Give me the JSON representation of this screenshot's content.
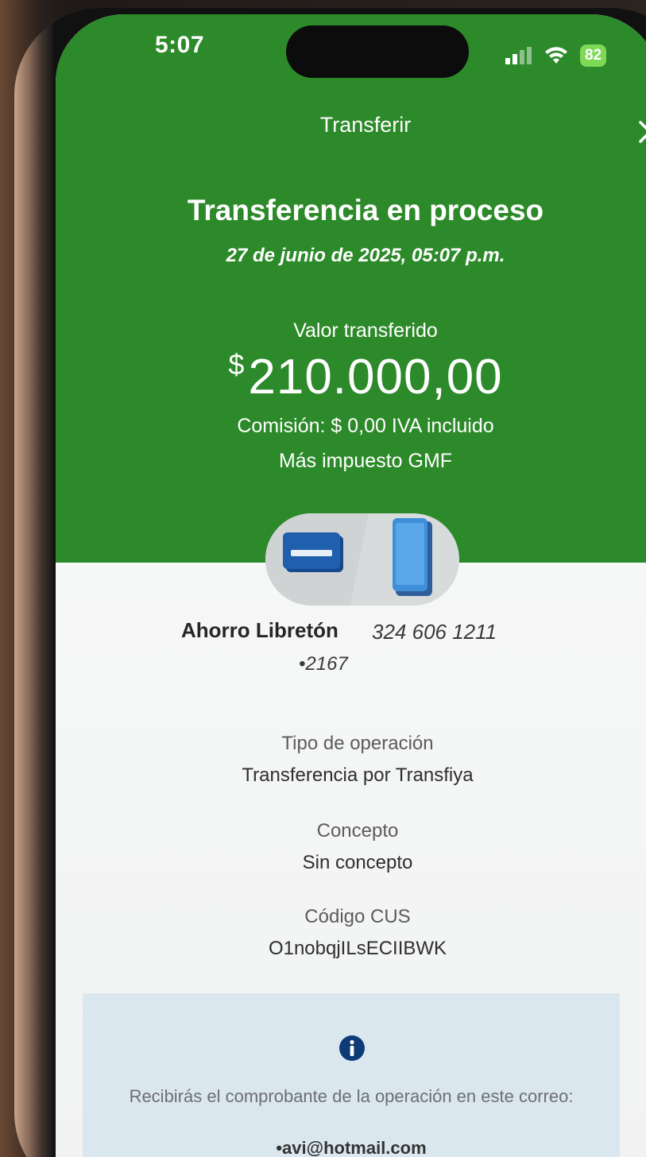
{
  "status_bar": {
    "time": "5:07",
    "battery": "82"
  },
  "header": {
    "title": "Transferir"
  },
  "result": {
    "headline": "Transferencia en proceso",
    "date": "27 de junio de 2025, 05:07 p.m.",
    "value_label": "Valor transferido",
    "currency_symbol": "$",
    "amount": "210.000,00",
    "commission": "Comisión: $ 0,00 IVA incluido",
    "tax_note": "Más impuesto GMF"
  },
  "account": {
    "name": "Ahorro Libretón",
    "destination_phone": "324 606 1211",
    "last_digits": "•2167"
  },
  "details": {
    "operation_type_label": "Tipo de operación",
    "operation_type_value": "Transferencia por Transfiya",
    "concept_label": "Concepto",
    "concept_value": "Sin concepto",
    "cus_label": "Código CUS",
    "cus_value": "O1nobqjILsECIIBWK"
  },
  "info": {
    "message": "Recibirás el comprobante de la operación en este correo:",
    "email": "•avi@hotmail.com"
  },
  "colors": {
    "header_green": "#2d8a2a",
    "card_blue": "#1f5fae",
    "info_box": "#dbe7ef",
    "info_icon": "#0d3b78"
  },
  "icons": {
    "close": "close-icon",
    "card": "card-icon",
    "phone": "phone-icon",
    "info": "info-icon",
    "signal": "signal-icon",
    "wifi": "wifi-icon"
  }
}
